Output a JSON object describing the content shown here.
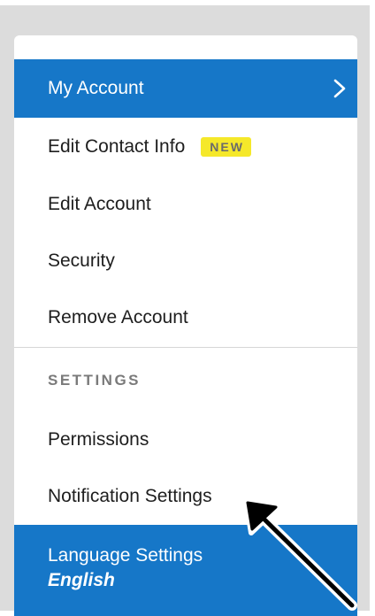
{
  "menu": {
    "items": [
      {
        "label": "My Account",
        "active": true
      },
      {
        "label": "Edit Contact Info",
        "badge": "NEW"
      },
      {
        "label": "Edit Account"
      },
      {
        "label": "Security"
      },
      {
        "label": "Remove Account"
      }
    ]
  },
  "settings": {
    "header": "SETTINGS",
    "items": [
      {
        "label": "Permissions"
      },
      {
        "label": "Notification Settings"
      },
      {
        "label": "Language Settings",
        "value": "English",
        "active": true
      }
    ]
  },
  "colors": {
    "active_background": "#1677c8",
    "badge_background": "#f5e82a",
    "frame_background": "#dcdcdc"
  },
  "icons": {
    "my_account_chevron": "chevron-right-icon",
    "annotation": "arrow-annotation-icon"
  }
}
